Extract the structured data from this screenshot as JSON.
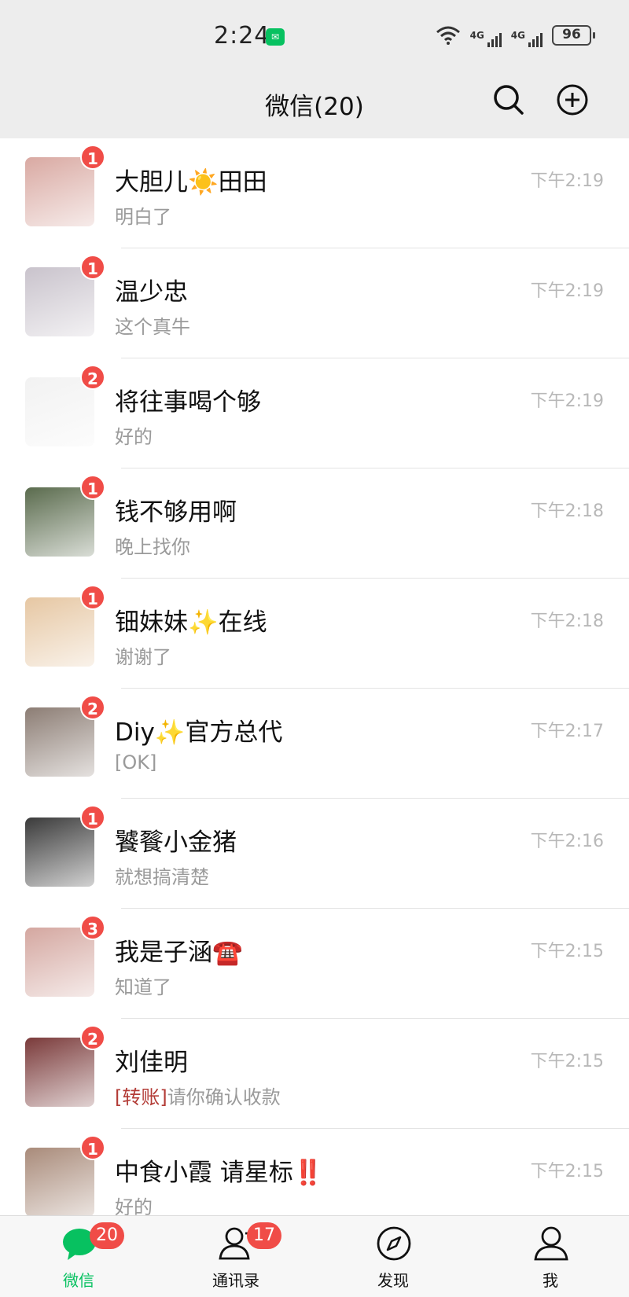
{
  "status_bar": {
    "time": "2:24",
    "app_notification_icon": "wechat-icon",
    "wifi_icon": "wifi-icon",
    "network_1": "4G",
    "network_2": "4G",
    "battery": "96"
  },
  "header": {
    "title": "微信(20)",
    "search_icon": "search-icon",
    "add_icon": "plus-circle-icon"
  },
  "chats": [
    {
      "name": "大胆儿☀️田田",
      "message": "明白了",
      "message_tag": "",
      "time": "下午2:19",
      "badge": "1",
      "avatar_color": "#d9a9a2"
    },
    {
      "name": "温少忠",
      "message": " 这个真牛",
      "message_tag": "",
      "time": "下午2:19",
      "badge": "1",
      "avatar_color": "#c9c3cc"
    },
    {
      "name": "将往事喝个够",
      "message": "好的",
      "message_tag": "",
      "time": "下午2:19",
      "badge": "2",
      "avatar_color": "#f2f2f2"
    },
    {
      "name": "钱不够用啊",
      "message": "晚上找你",
      "message_tag": "",
      "time": "下午2:18",
      "badge": "1",
      "avatar_color": "#5a6b4d"
    },
    {
      "name": "钿妹妹✨在线",
      "message": "谢谢了",
      "message_tag": "",
      "time": "下午2:18",
      "badge": "1",
      "avatar_color": "#e6c7a3"
    },
    {
      "name": "Diy✨官方总代",
      "message": "[OK]",
      "message_tag": "",
      "time": "下午2:17",
      "badge": "2",
      "avatar_color": "#8c7d74"
    },
    {
      "name": "饕餮小金猪",
      "message": "就想搞清楚",
      "message_tag": "",
      "time": "下午2:16",
      "badge": "1",
      "avatar_color": "#3a3a3a"
    },
    {
      "name": "我是子涵☎️",
      "message": "知道了",
      "message_tag": "",
      "time": "下午2:15",
      "badge": "3",
      "avatar_color": "#d4a7a0"
    },
    {
      "name": "刘佳明",
      "message": "请你确认收款",
      "message_tag": "[转账]",
      "time": "下午2:15",
      "badge": "2",
      "avatar_color": "#7a3a3a"
    },
    {
      "name": "   中食小霞   请星标‼️",
      "message": "好的",
      "message_tag": "",
      "time": "下午2:15",
      "badge": "1",
      "avatar_color": "#a98b7a"
    }
  ],
  "tabbar": {
    "chats": {
      "label": "微信",
      "badge": "20",
      "icon": "chat-bubble-icon"
    },
    "contacts": {
      "label": "通讯录",
      "badge": "17",
      "icon": "contacts-icon"
    },
    "discover": {
      "label": "发现",
      "icon": "compass-icon"
    },
    "me": {
      "label": "我",
      "icon": "person-icon"
    }
  },
  "colors": {
    "accent": "#07c160",
    "badge": "#f04c47",
    "background": "#ededed"
  }
}
